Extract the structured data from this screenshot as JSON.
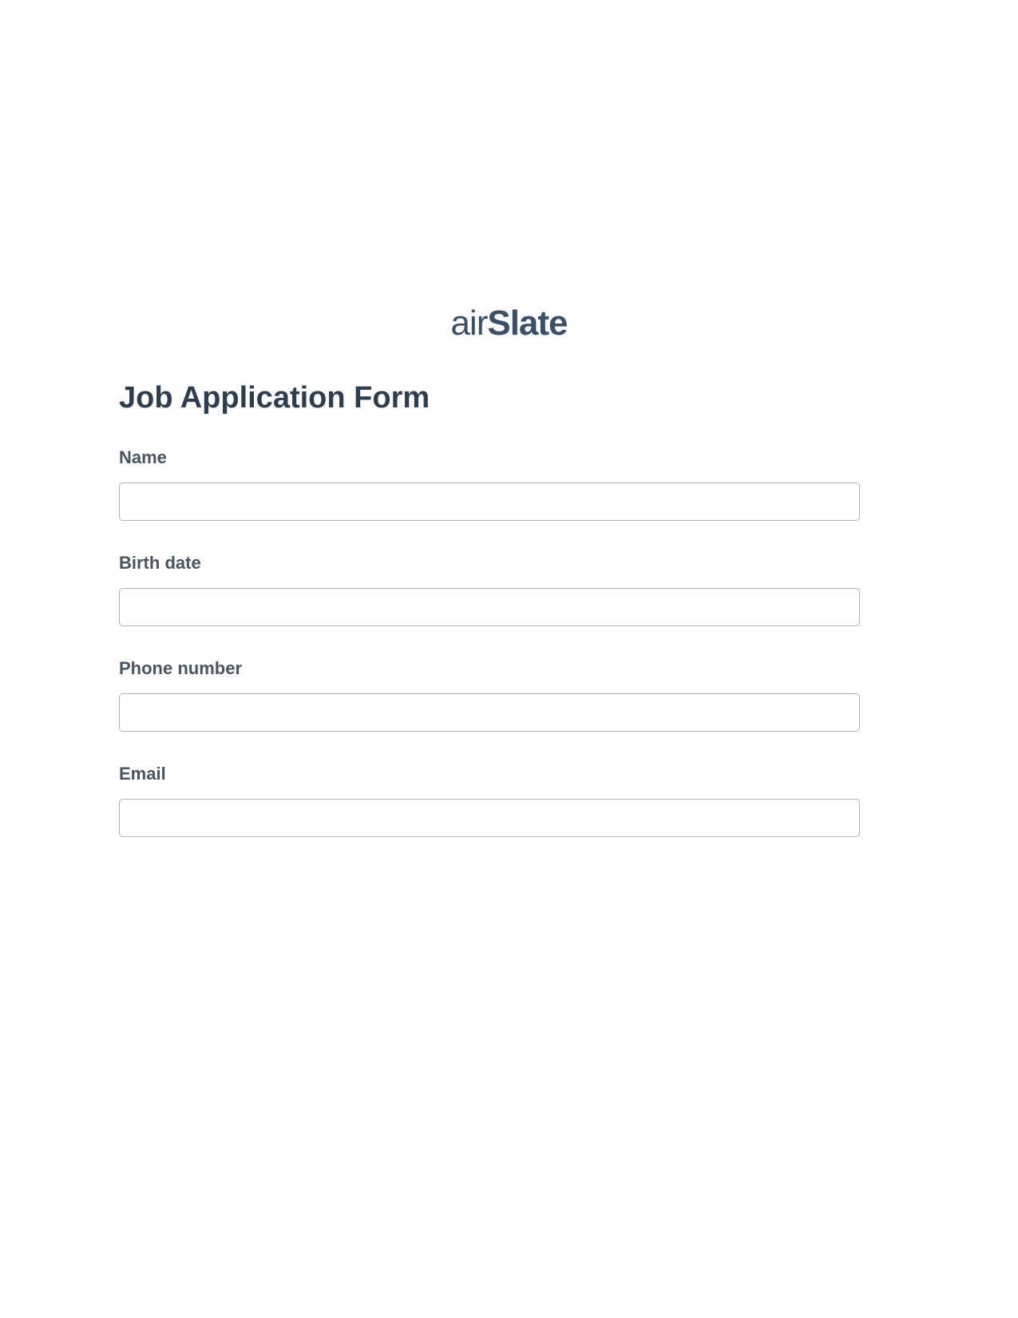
{
  "logo": {
    "part1": "air",
    "part2": "Slate"
  },
  "form": {
    "title": "Job Application Form",
    "fields": {
      "name": {
        "label": "Name",
        "value": ""
      },
      "birth_date": {
        "label": "Birth date",
        "value": ""
      },
      "phone_number": {
        "label": "Phone number",
        "value": ""
      },
      "email": {
        "label": "Email",
        "value": ""
      }
    }
  }
}
